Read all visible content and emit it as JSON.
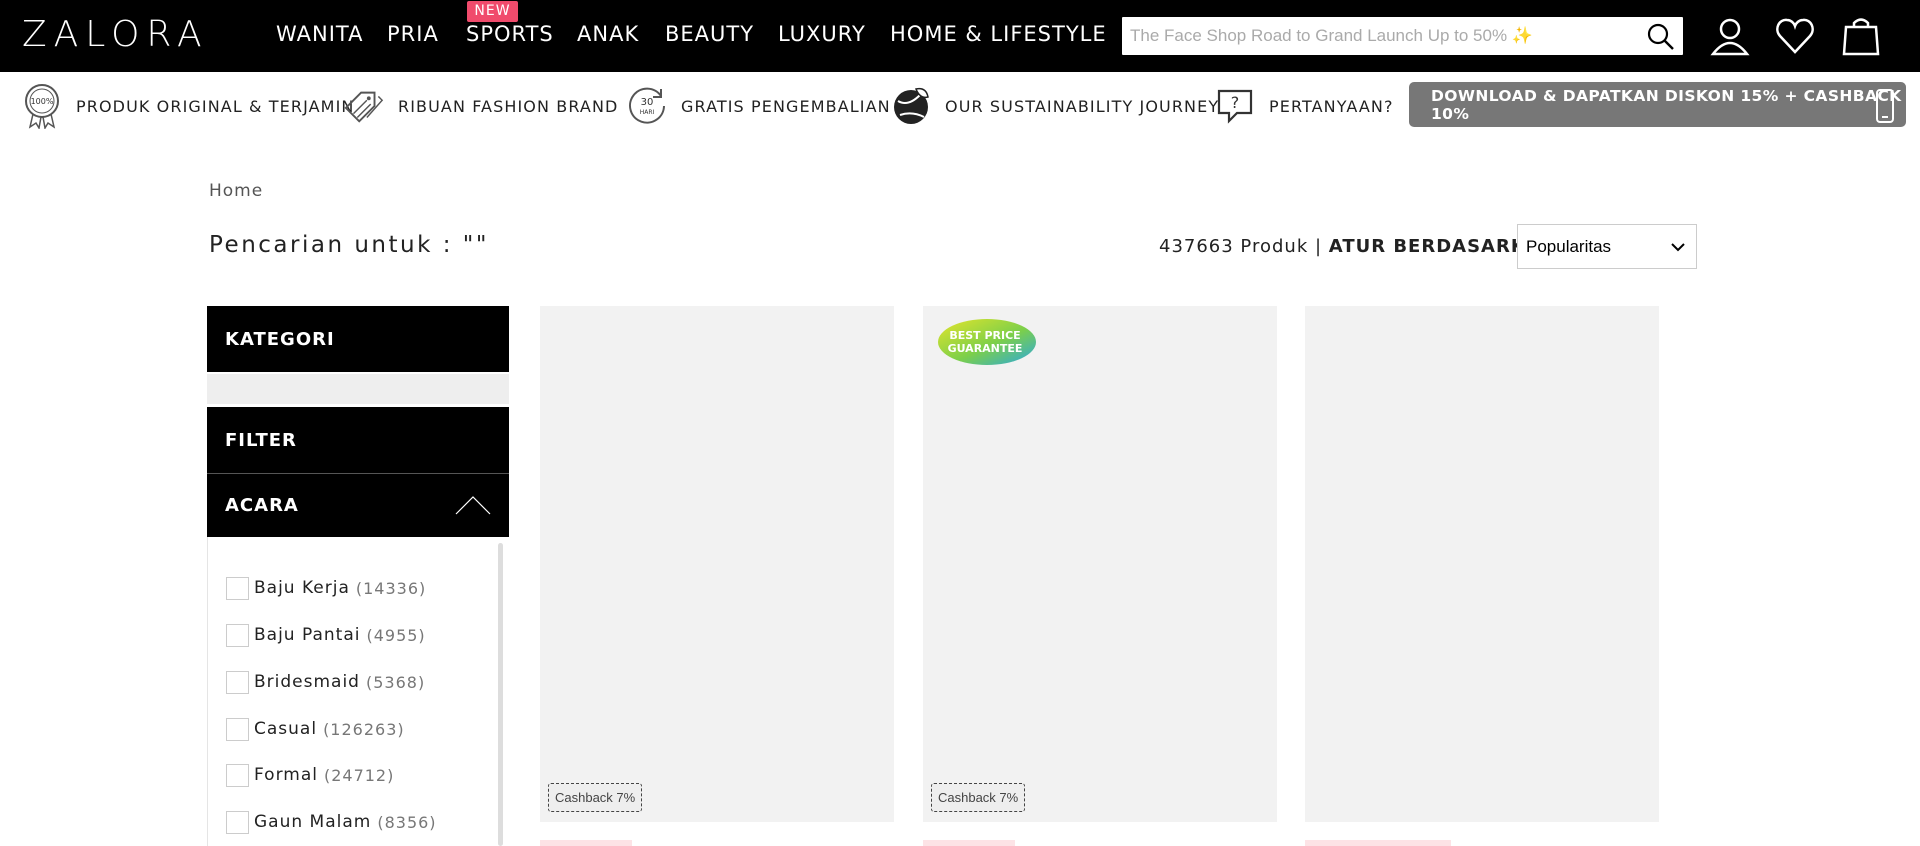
{
  "brand": {
    "logo": "ZALORA"
  },
  "nav": {
    "items": [
      "WANITA",
      "PRIA",
      "SPORTS",
      "ANAK",
      "BEAUTY",
      "LUXURY",
      "HOME & LIFESTYLE"
    ],
    "new_badge": "NEW"
  },
  "search": {
    "placeholder": "The Face Shop Road to Grand Launch Up to 50% ✨"
  },
  "usp": [
    {
      "icon": "original-badge-icon",
      "label": "PRODUK ORIGINAL & TERJAMIN"
    },
    {
      "icon": "price-tags-icon",
      "label": "RIBUAN FASHION BRAND"
    },
    {
      "icon": "30-days-return-icon",
      "label": "GRATIS PENGEMBALIAN"
    },
    {
      "icon": "globe-leaf-icon",
      "label": "OUR SUSTAINABILITY JOURNEY"
    },
    {
      "icon": "question-bubble-icon",
      "label": "PERTANYAAN?"
    }
  ],
  "download_banner": "DOWNLOAD & DAPATKAN DISKON 15% + CASHBACK 10%",
  "breadcrumb": "Home",
  "search_title": "Pencarian untuk : \"\"",
  "result": {
    "count_text": "437663 Produk |",
    "sort_label": "ATUR BERDASARKAN"
  },
  "sort": {
    "selected": "Popularitas"
  },
  "sidebar": {
    "kategori": "KATEGORI",
    "filter": "FILTER",
    "acara": "ACARA",
    "options": [
      {
        "label": "Baju Kerja",
        "count": "(14336)"
      },
      {
        "label": "Baju Pantai",
        "count": "(4955)"
      },
      {
        "label": "Bridesmaid",
        "count": "(5368)"
      },
      {
        "label": "Casual",
        "count": "(126263)"
      },
      {
        "label": "Formal",
        "count": "(24712)"
      },
      {
        "label": "Gaun Malam",
        "count": "(8356)"
      }
    ]
  },
  "products": [
    {
      "cashback": "Cashback 7%",
      "badge": ""
    },
    {
      "cashback": "Cashback 7%",
      "badge": "BEST PRICE GUARANTEE"
    },
    {
      "cashback": "",
      "badge": ""
    }
  ],
  "colors": {
    "nav_bg": "#000000",
    "new_badge": "#f04b6c",
    "download_bg": "#777777",
    "product_bg": "#f2f2f2"
  }
}
